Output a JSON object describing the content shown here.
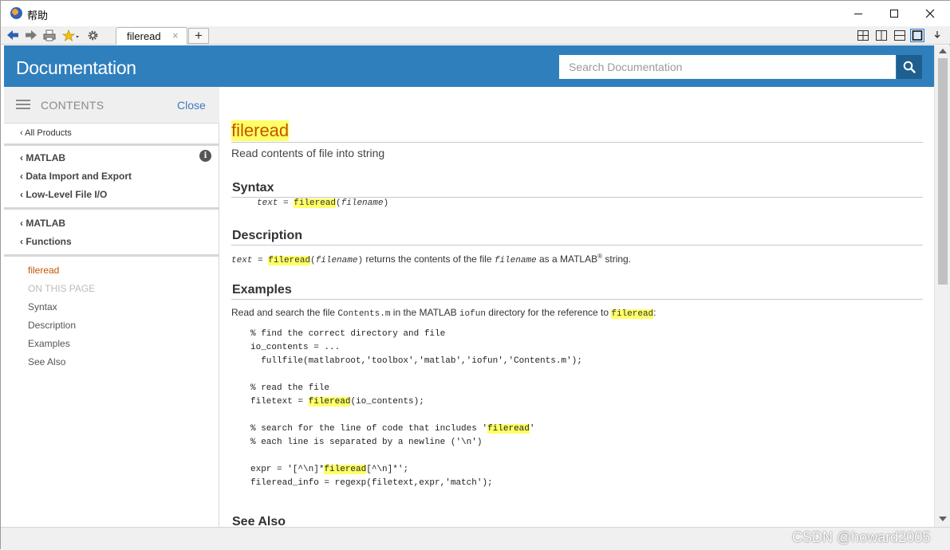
{
  "window": {
    "title": "帮助"
  },
  "toolbar": {
    "tab_label": "fileread",
    "tab_close": "×",
    "tab_add": "+",
    "icons": [
      "back-arrow-icon",
      "forward-arrow-icon",
      "print-icon",
      "favorites-star-icon",
      "settings-gear-icon"
    ]
  },
  "header": {
    "title": "Documentation",
    "search_placeholder": "Search Documentation"
  },
  "sidebar": {
    "contents_label": "CONTENTS",
    "close_label": "Close",
    "all_products": "‹ All Products",
    "crumbs_group1": [
      "‹ MATLAB",
      "‹ Data Import and Export",
      "‹ Low-Level File I/O"
    ],
    "crumbs_group2": [
      "‹ MATLAB",
      "‹ Functions"
    ],
    "current_page": "fileread",
    "on_this_page": "ON THIS PAGE",
    "toc": [
      "Syntax",
      "Description",
      "Examples",
      "See Also"
    ]
  },
  "content": {
    "title": "fileread",
    "purpose": "Read contents of file into string",
    "syntax_heading": "Syntax",
    "syntax": {
      "out": "text",
      "eq": " = ",
      "fn": "fileread",
      "open": "(",
      "arg": "filename",
      "close": ")"
    },
    "description_heading": "Description",
    "description": {
      "out": "text",
      "eq": " = ",
      "fn": "fileread",
      "open": "(",
      "arg": "filename",
      "close": ")",
      "text1": " returns the contents of the file ",
      "arg2": "filename",
      "text2": " as a MATLAB",
      "reg": "®",
      "text3": " string."
    },
    "examples_heading": "Examples",
    "examples_intro": {
      "t1": "Read and search the file ",
      "file": "Contents.m",
      "t2": " in the MATLAB ",
      "dir": "iofun",
      "t3": " directory for the reference to ",
      "fn": "fileread",
      "t4": ":"
    },
    "code": {
      "l1": "% find the correct directory and file",
      "l2": "io_contents = ...",
      "l3": "  fullfile(matlabroot,'toolbox','matlab','iofun','Contents.m');",
      "l4": "% read the file",
      "l5a": "filetext = ",
      "l5b": "fileread",
      "l5c": "(io_contents);",
      "l6a": "% search for the line of code that includes '",
      "l6b": "fileread",
      "l6c": "'",
      "l7": "% each line is separated by a newline ('\\n')",
      "l8a": "expr = '[^\\n]*",
      "l8b": "fileread",
      "l8c": "[^\\n]*';",
      "l9": "fileread_info = regexp(filetext,expr,'match');"
    },
    "see_also_heading": "See Also"
  },
  "watermark": "CSDN @howard2005"
}
